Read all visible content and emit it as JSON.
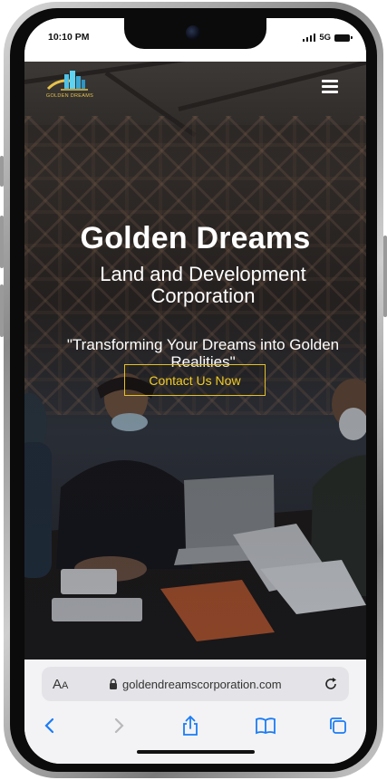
{
  "status_bar": {
    "time": "10:10 PM",
    "network": "5G",
    "icons": [
      "signal-icon",
      "battery-icon"
    ]
  },
  "nav": {
    "logo_text": "GOLDEN DREAMS",
    "logo_icon": "building-logo-icon",
    "menu_icon": "hamburger-menu-icon"
  },
  "hero": {
    "title": "Golden Dreams",
    "subtitle": "Land and Development Corporation",
    "tagline": "\"Transforming Your Dreams into Golden Realities\"",
    "cta_label": "Contact Us Now",
    "background_image": "team-meeting-photo"
  },
  "browser": {
    "text_size_label": "AA",
    "url": "goldendreamscorporation.com",
    "icons": [
      "lock-icon",
      "reload-icon",
      "back-icon",
      "forward-icon",
      "share-icon",
      "bookmarks-icon",
      "tabs-icon"
    ]
  },
  "colors": {
    "accent_gold": "#f1cc22",
    "cta_border": "#e3c02a",
    "ios_blue": "#1a7cf5",
    "browser_bg": "#f3f3f5"
  }
}
